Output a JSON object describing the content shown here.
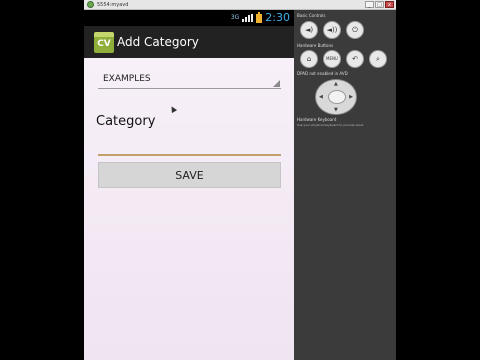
{
  "window": {
    "title": "5554:myavd",
    "minimize": "_",
    "maximize": "□",
    "close": "x"
  },
  "statusbar": {
    "network": "3G",
    "time": "2:30"
  },
  "actionbar": {
    "icon_text": "CV",
    "title": "Add Category"
  },
  "form": {
    "spinner_value": "EXAMPLES",
    "category_label": "Category",
    "category_value": "",
    "save_label": "SAVE"
  },
  "controls": {
    "basic_controls_label": "Basic Controls",
    "volume_down_glyph": "◄)",
    "volume_up_glyph": "◄))",
    "power_glyph": "⏻",
    "hardware_buttons_label": "Hardware Buttons",
    "home_glyph": "⌂",
    "menu_label": "MENU",
    "back_glyph": "↶",
    "search_glyph": "⌕",
    "dpad_label": "DPAD not enabled in AVD",
    "keyboard_label": "Hardware Keyboard",
    "keyboard_note": "Use your physical keyboard to provide input"
  },
  "colors": {
    "clock": "#3fb0e8",
    "app_icon": "#8fae3a",
    "input_underline": "#c2a06a"
  }
}
